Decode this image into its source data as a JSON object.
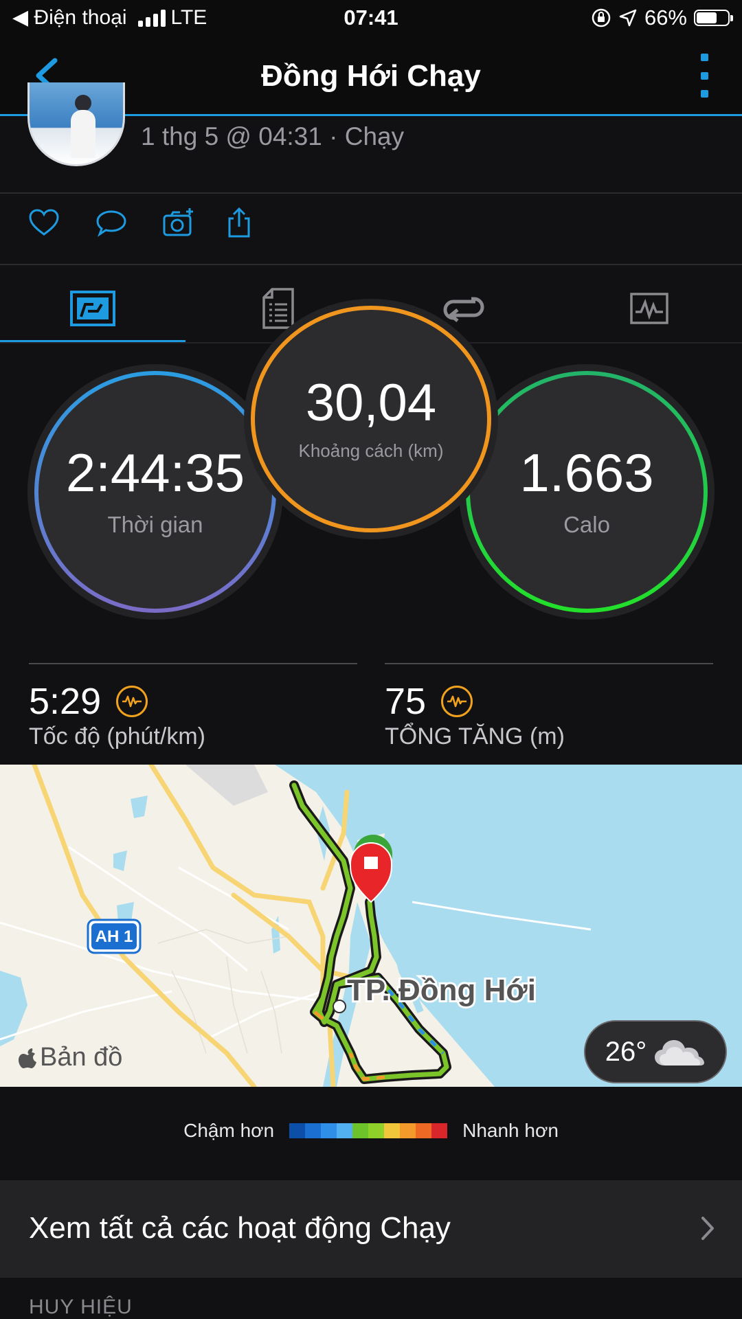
{
  "status_bar": {
    "back_app": "◀ Điện thoại",
    "network": "LTE",
    "time": "07:41",
    "battery": "66%",
    "battery_level": 0.66
  },
  "header": {
    "title": "Đồng Hới Chạy",
    "accent": "#1e9be0"
  },
  "activity": {
    "meta": "1 thg 5 @ 04:31 · Chạy"
  },
  "actions": [
    "like-icon",
    "comment-icon",
    "add-photo-icon",
    "share-icon"
  ],
  "tabs": [
    {
      "icon": "overview-icon",
      "active": true
    },
    {
      "icon": "details-icon",
      "active": false
    },
    {
      "icon": "laps-icon",
      "active": false
    },
    {
      "icon": "graphs-icon",
      "active": false
    }
  ],
  "circles": {
    "time": {
      "value": "2:44:35",
      "label": "Thời gian"
    },
    "distance": {
      "value": "30,04",
      "label": "Khoảng cách (km)"
    },
    "calories": {
      "value": "1.663",
      "label": "Calo"
    }
  },
  "stats": {
    "pace": {
      "value": "5:29",
      "label": "Tốc độ (phút/km)"
    },
    "elevation": {
      "value": "75",
      "label": "TỔNG TĂNG (m)"
    }
  },
  "map": {
    "city_label": "TP. Đồng Hới",
    "road_badge": "AH 1",
    "brand": "Bản đồ",
    "weather": "26°"
  },
  "legend": {
    "slower": "Chậm hơn",
    "faster": "Nhanh hơn",
    "colors": [
      "#0b4fa8",
      "#1a6fd0",
      "#2f8fe8",
      "#53b0f0",
      "#6cc42a",
      "#8fd12a",
      "#f2c63a",
      "#f29a2a",
      "#ee6a24",
      "#d8262a"
    ]
  },
  "list": {
    "all_runs": "Xem tất cả các hoạt động Chạy"
  },
  "section": {
    "badges": "HUY HIỆU"
  }
}
